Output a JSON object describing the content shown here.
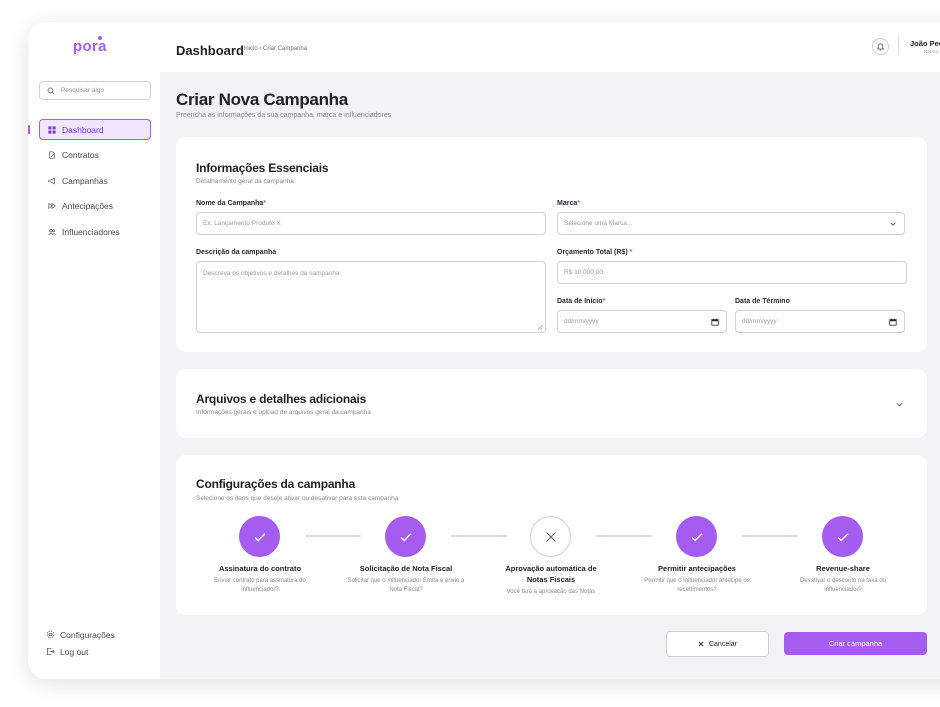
{
  "brand": {
    "logo_text": "pora",
    "accent": "#a55cf0"
  },
  "sidebar": {
    "search_placeholder": "Pesquisar algo",
    "items": [
      {
        "label": "Dashboard",
        "icon": "grid-icon",
        "active": true
      },
      {
        "label": "Contratos",
        "icon": "document-edit-icon"
      },
      {
        "label": "Campanhas",
        "icon": "megaphone-icon"
      },
      {
        "label": "Antecipações",
        "icon": "fast-forward-icon"
      },
      {
        "label": "Influenciadores",
        "icon": "users-icon"
      }
    ],
    "bottom": [
      {
        "label": "Configurações",
        "icon": "gear-icon"
      },
      {
        "label": "Log out",
        "icon": "logout-icon"
      }
    ]
  },
  "header": {
    "title": "Dashboard",
    "breadcrumb": "› Inicio › Criar Campanha",
    "user_name": "João Pedro",
    "user_role": "Nat Co"
  },
  "page": {
    "title": "Criar Nova Campanha",
    "subtitle": "Preencha as informações da sua campanha, marca e influenciadores"
  },
  "essentials": {
    "title": "Informações Essenciais",
    "subtitle": "Detalhamento geral da campanha",
    "campaign_name_label": "Nome da Campanha",
    "campaign_name_placeholder": "Ex: Lançamento Produto X",
    "brand_label": "Marca",
    "brand_placeholder": "Selecione uma Marca...",
    "description_label": "Descrição da campanha",
    "description_placeholder": "Descreva os objetivos e detalhes da campanha",
    "budget_label": "Orçamento Total (R$)",
    "budget_placeholder": "R$ 10.000,00",
    "start_label": "Data de Início",
    "start_placeholder": "dd/mm/yyyy",
    "end_label": "Data de Término",
    "end_placeholder": "dd/mm/yyyy",
    "required_mark": "*"
  },
  "files": {
    "title": "Arquivos e detalhes adicionais",
    "subtitle": "Informações gerais e upload de arquivos geral da campanha"
  },
  "settings": {
    "title": "Configurações da campanha",
    "subtitle": "Selecione os itens que deseje ativar ou desativar para esta campanha",
    "steps": [
      {
        "title": "Assinatura do contrato",
        "desc": "Enviar contrato para assinatura do influenciador?",
        "enabled": true
      },
      {
        "title": "Solicitação de Nota Fiscal",
        "desc": "Solicitar que o influenciador Emita e envie a Nota Fiscal?",
        "enabled": true
      },
      {
        "title": "Aprovação automática de Notas Fiscais",
        "desc": "Você fará a aprovação das Notas",
        "enabled": false
      },
      {
        "title": "Permitir antecipações",
        "desc": "Permitir que o influenciador antecipe os recebimentos?",
        "enabled": true
      },
      {
        "title": "Revenue-share",
        "desc": "Desativar o desconto na taxa do influenciador?",
        "enabled": true
      }
    ]
  },
  "actions": {
    "cancel_label": "Cancelar",
    "create_label": "Criar campanha"
  }
}
